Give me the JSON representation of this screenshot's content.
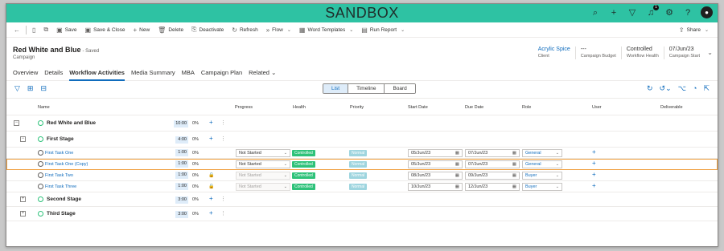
{
  "app": {
    "environment_banner": "SANDBOX",
    "notification_count": "1",
    "avatar_initials": "●"
  },
  "commands": [
    {
      "label": "",
      "icon": "back-arrow-icon"
    },
    {
      "label": "",
      "icon": "record-icon"
    },
    {
      "label": "",
      "icon": "new-window-icon"
    },
    {
      "label": "Save",
      "icon": "save-icon"
    },
    {
      "label": "Save & Close",
      "icon": "save-close-icon"
    },
    {
      "label": "New",
      "icon": "plus-icon"
    },
    {
      "label": "Delete",
      "icon": "delete-icon"
    },
    {
      "label": "Deactivate",
      "icon": "deactivate-icon"
    },
    {
      "label": "Refresh",
      "icon": "refresh-icon"
    },
    {
      "label": "Flow",
      "icon": "flow-icon",
      "dropdown": true
    },
    {
      "label": "Word Templates",
      "icon": "word-icon",
      "dropdown": true
    },
    {
      "label": "Run Report",
      "icon": "report-icon",
      "dropdown": true
    }
  ],
  "share_label": "Share",
  "record": {
    "title": "Red White and Blue",
    "saved": "- Saved",
    "entity": "Campaign"
  },
  "header_fields": [
    {
      "value": "Acrylic Spice",
      "label": "Client",
      "link": true
    },
    {
      "value": "---",
      "label": "Campaign Budget",
      "link": false
    },
    {
      "value": "Controlled",
      "label": "Workflow Health",
      "link": false
    },
    {
      "value": "07/Jun/23",
      "label": "Campaign Start",
      "link": false
    }
  ],
  "tabs": [
    "Overview",
    "Details",
    "Workflow Activities",
    "Media Summary",
    "MBA",
    "Campaign Plan",
    "Related"
  ],
  "active_tab": "Workflow Activities",
  "views": {
    "list": "List",
    "timeline": "Timeline",
    "board": "Board"
  },
  "columns": {
    "name": "Name",
    "progress": "Progress",
    "health": "Health",
    "priority": "Priority",
    "start": "Start Date",
    "due": "Due Date",
    "role": "Role",
    "user": "User",
    "deliverable": "Deliverable"
  },
  "colors": {
    "accent": "#0f6cbd",
    "banner": "#2ec2a3",
    "controlled": "#2ec27a",
    "normal": "#9ed5df",
    "highlight": "#f0a040"
  },
  "rows": [
    {
      "kind": "campaign",
      "name": "Red White and Blue",
      "duration": "10:00",
      "pct": "0%"
    },
    {
      "kind": "stage",
      "name": "First Stage",
      "duration": "4:00",
      "pct": "0%",
      "expanded": true
    },
    {
      "kind": "task",
      "name": "First Task One",
      "duration": "1:00",
      "pct": "0%",
      "locked": false,
      "progress": "Not Started",
      "progress_disabled": false,
      "health": "Controlled",
      "priority": "Normal",
      "start": "05/Jun/23",
      "due": "07/Jun/23",
      "role": "General",
      "highlight": false
    },
    {
      "kind": "task",
      "name": "First Task One (Copy)",
      "duration": "1:00",
      "pct": "0%",
      "locked": false,
      "progress": "Not Started",
      "progress_disabled": false,
      "health": "Controlled",
      "priority": "Normal",
      "start": "05/Jun/23",
      "due": "07/Jun/23",
      "role": "General",
      "highlight": true
    },
    {
      "kind": "task",
      "name": "First Task Two",
      "duration": "1:00",
      "pct": "0%",
      "locked": true,
      "progress": "Not Started",
      "progress_disabled": true,
      "health": "Controlled",
      "priority": "Normal",
      "start": "08/Jun/23",
      "due": "09/Jun/23",
      "role": "Buyer",
      "highlight": false
    },
    {
      "kind": "task",
      "name": "First Task Three",
      "duration": "1:00",
      "pct": "0%",
      "locked": true,
      "progress": "Not Started",
      "progress_disabled": true,
      "health": "Controlled",
      "priority": "Normal",
      "start": "10/Jun/23",
      "due": "12/Jun/23",
      "role": "Buyer",
      "highlight": false
    },
    {
      "kind": "stage",
      "name": "Second Stage",
      "duration": "3:00",
      "pct": "0%",
      "expanded": false
    },
    {
      "kind": "stage",
      "name": "Third Stage",
      "duration": "3:00",
      "pct": "0%",
      "expanded": false
    }
  ]
}
